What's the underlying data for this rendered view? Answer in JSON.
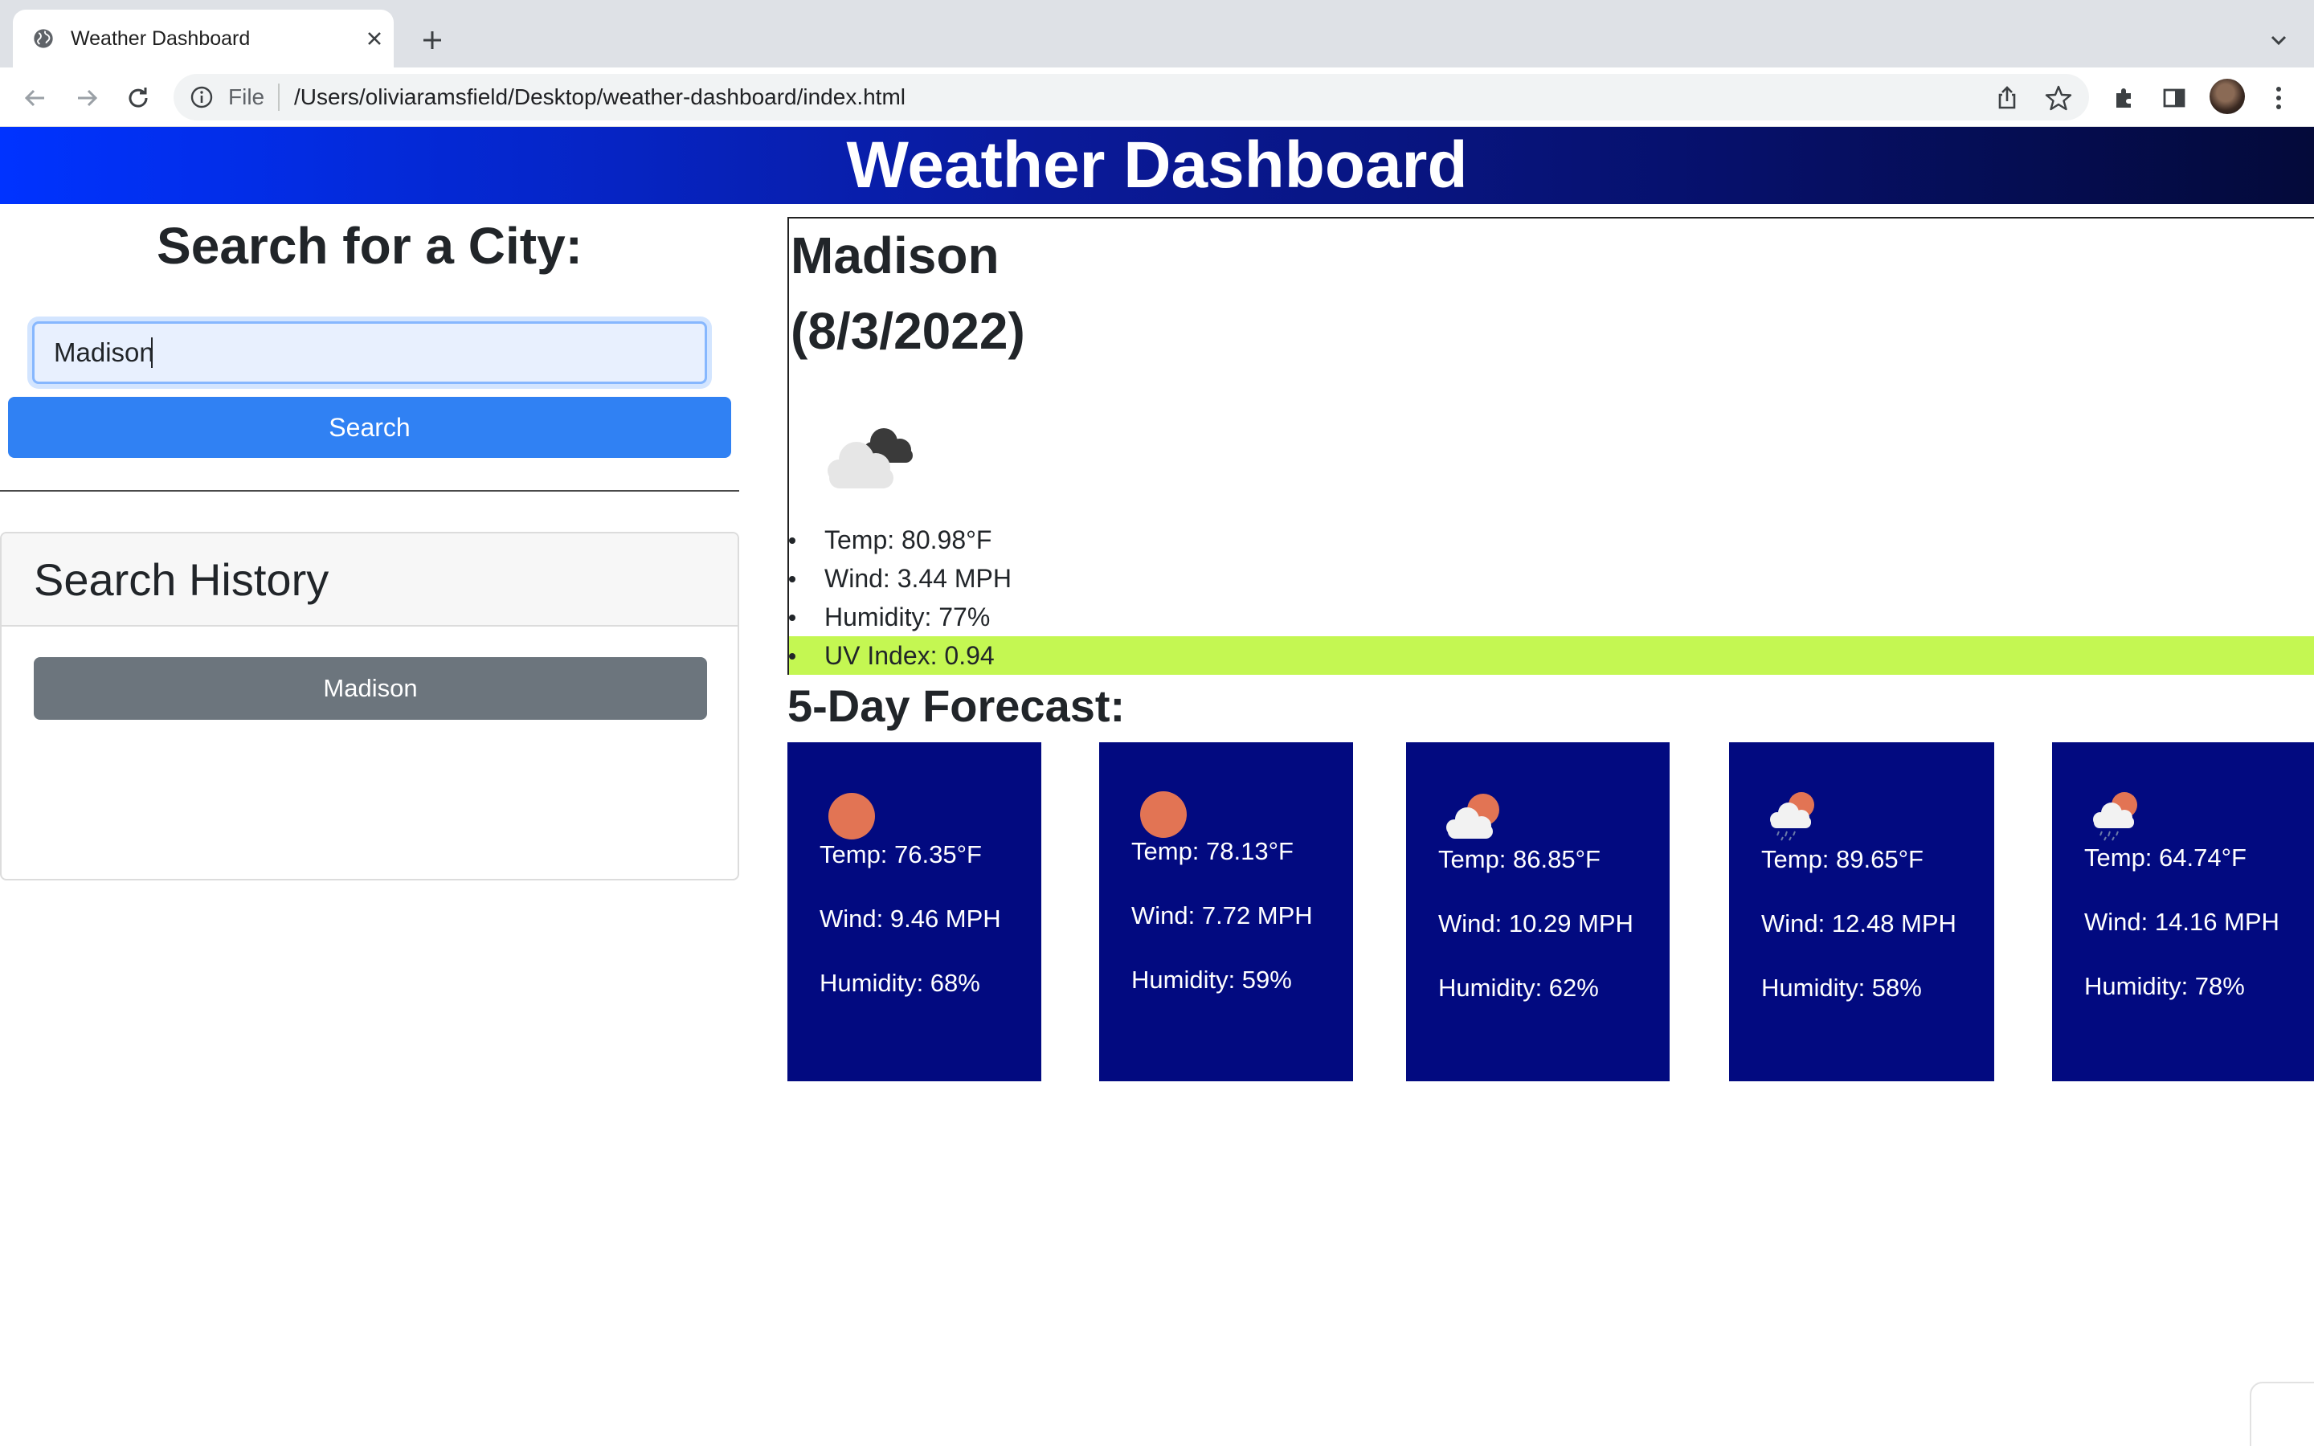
{
  "browser": {
    "tab_title": "Weather Dashboard",
    "omnibox_scheme": "File",
    "url": "/Users/oliviaramsfield/Desktop/weather-dashboard/index.html"
  },
  "header": {
    "title": "Weather Dashboard"
  },
  "search": {
    "title": "Search for a City:",
    "input_value": "Madison",
    "button_label": "Search"
  },
  "history": {
    "title": "Search History",
    "items": [
      "Madison"
    ]
  },
  "current": {
    "city": "Madison",
    "date": "(8/3/2022)",
    "icon": "broken-clouds-icon",
    "temp": "Temp: 80.98°F",
    "wind": "Wind: 3.44 MPH",
    "humidity": "Humidity: 77%",
    "uv": "UV Index: 0.94",
    "uv_color": "#c4f752"
  },
  "forecast": {
    "title": "5-Day Forecast:",
    "card_color": "#020a80",
    "days": [
      {
        "icon": "clear-sun-icon",
        "temp": "Temp: 76.35°F",
        "wind": "Wind: 9.46 MPH",
        "humidity": "Humidity: 68%"
      },
      {
        "icon": "clear-sun-icon",
        "temp": "Temp: 78.13°F",
        "wind": "Wind: 7.72 MPH",
        "humidity": "Humidity: 59%"
      },
      {
        "icon": "partly-cloudy-icon",
        "temp": "Temp: 86.85°F",
        "wind": "Wind: 10.29 MPH",
        "humidity": "Humidity: 62%"
      },
      {
        "icon": "rain-cloud-icon",
        "temp": "Temp: 89.65°F",
        "wind": "Wind: 12.48 MPH",
        "humidity": "Humidity: 58%"
      },
      {
        "icon": "rain-cloud-icon",
        "temp": "Temp: 64.74°F",
        "wind": "Wind: 14.16 MPH",
        "humidity": "Humidity: 78%"
      }
    ]
  }
}
